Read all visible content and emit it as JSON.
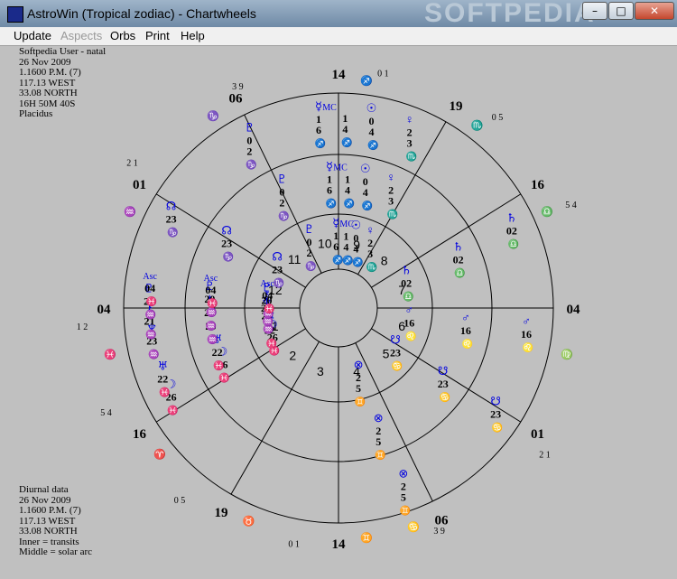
{
  "window": {
    "title": "AstroWin (Tropical zodiac) - Chartwheels",
    "watermark": "SOFTPEDIA",
    "minimize": "–",
    "maximize": "□",
    "close": "✕"
  },
  "menu": [
    {
      "label": "Update",
      "enabled": true
    },
    {
      "label": "Aspects",
      "enabled": false
    },
    {
      "label": "Orbs",
      "enabled": true
    },
    {
      "label": "Print",
      "enabled": true
    },
    {
      "label": "Help",
      "enabled": true
    }
  ],
  "top_info": [
    "Softpedia User - natal",
    "26 Nov 2009",
    "1.1600 P.M. (7)",
    "117.13 WEST",
    "33.08 NORTH",
    "16H  50M  40S",
    "Placidus"
  ],
  "bottom_info": [
    "Diurnal data",
    "26 Nov 2009",
    "1.1600 P.M. (7)",
    "117.13 WEST",
    "33.08 NORTH",
    "Inner = transits",
    "Middle = solar arc"
  ],
  "colors": {
    "black": "#000000",
    "red": "#e00000",
    "blue": "#0000e0"
  },
  "chart": {
    "house_numbers": [
      "1",
      "2",
      "3",
      "4",
      "5",
      "6",
      "7",
      "8",
      "9",
      "10",
      "11",
      "12"
    ],
    "cusp_labels": [
      {
        "deg": "14",
        "min": "0 1",
        "sign": "♐"
      },
      {
        "deg": "19",
        "min": "0 5",
        "sign": "♏"
      },
      {
        "deg": "16",
        "min": "5 4",
        "sign": "♎"
      },
      {
        "deg": "04",
        "min": "",
        "sign": "♍"
      },
      {
        "deg": "01",
        "min": "2 1",
        "sign": ""
      },
      {
        "deg": "06",
        "min": "3 9",
        "sign": "♋"
      },
      {
        "deg": "14",
        "min": "0 1",
        "sign": "♊"
      },
      {
        "deg": "19",
        "min": "0 5",
        "sign": "♉"
      },
      {
        "deg": "16",
        "min": "5 4",
        "sign": "♈"
      },
      {
        "deg": "04",
        "min": "1 2",
        "sign": "♓"
      },
      {
        "deg": "01",
        "min": "2 1",
        "sign": "♒"
      },
      {
        "deg": "06",
        "min": "3 9",
        "sign": "♑"
      }
    ],
    "outer_planets": [
      {
        "glyph": "☿",
        "label": "MC",
        "values": [
          "1",
          "6"
        ],
        "sign": "♐"
      },
      {
        "glyph": "",
        "label": "",
        "values": [
          "1",
          "4"
        ],
        "sign": "♐"
      },
      {
        "glyph": "☉",
        "label": "",
        "values": [
          "0",
          "4"
        ],
        "sign": "♐"
      },
      {
        "glyph": "♀",
        "label": "",
        "values": [
          "2",
          "3"
        ],
        "sign": "♏"
      },
      {
        "glyph": "♄",
        "label": "",
        "values": [
          "02"
        ],
        "sign": "♎"
      },
      {
        "glyph": "♂",
        "label": "",
        "values": [
          "16"
        ],
        "sign": "♌"
      },
      {
        "glyph": "☋",
        "label": "",
        "values": [
          "23"
        ],
        "sign": "♋"
      },
      {
        "glyph": "⊗",
        "label": "",
        "values": [
          "2",
          "5"
        ],
        "sign": "♊"
      },
      {
        "glyph": "☽",
        "label": "",
        "values": [
          "26"
        ],
        "sign": "♓"
      },
      {
        "glyph": "♅",
        "label": "",
        "values": [
          "22"
        ],
        "sign": "♓"
      },
      {
        "glyph": "♆",
        "label": "",
        "values": [
          "23"
        ],
        "sign": "♒"
      },
      {
        "glyph": "⚷",
        "label": "",
        "values": [
          "21"
        ],
        "sign": "♒"
      },
      {
        "glyph": "♇",
        "label": "",
        "values": [
          "20"
        ],
        "sign": "♒"
      },
      {
        "glyph": "",
        "label": "Asc",
        "values": [
          "04"
        ],
        "sign": "♓"
      },
      {
        "glyph": "☊",
        "label": "",
        "values": [
          "23"
        ],
        "sign": "♑"
      },
      {
        "glyph": "♇",
        "label": "",
        "values": [
          "0",
          "2"
        ],
        "sign": "♑"
      }
    ]
  }
}
